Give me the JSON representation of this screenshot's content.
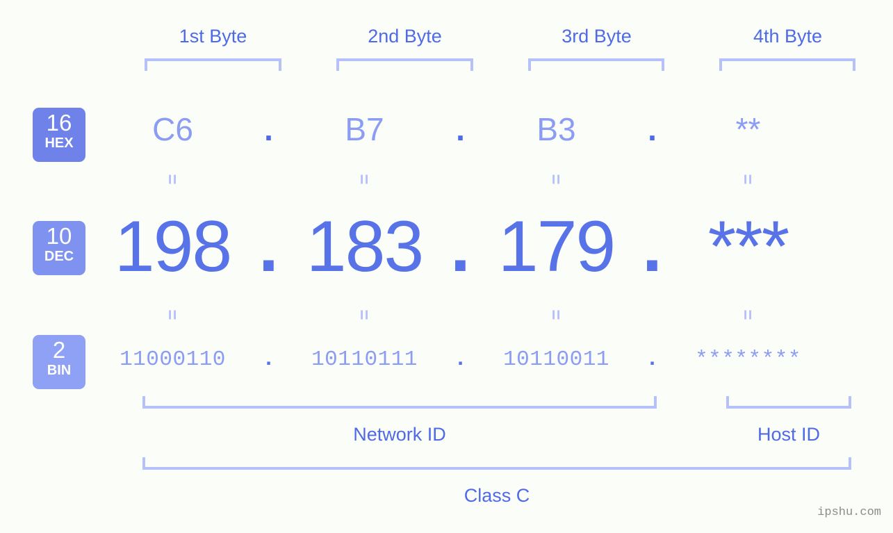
{
  "background_color": "#fbfdf8",
  "accent_colors": {
    "label_blue": "#4f6ae6",
    "value_blue": "#5872e8",
    "light_blue": "#8b9cf3",
    "bracket_blue": "#b6c0fa",
    "badge_hex": "#6e82ea",
    "badge_dec": "#7f92f0",
    "badge_bin": "#8fa1f5",
    "watermark_gray": "#8c8c8c"
  },
  "byte_headers": [
    {
      "label": "1st Byte"
    },
    {
      "label": "2nd Byte"
    },
    {
      "label": "3rd Byte"
    },
    {
      "label": "4th Byte"
    }
  ],
  "bases": {
    "hex": {
      "number": "16",
      "abbr": "HEX"
    },
    "dec": {
      "number": "10",
      "abbr": "DEC"
    },
    "bin": {
      "number": "2",
      "abbr": "BIN"
    }
  },
  "rows": {
    "hex": {
      "values": [
        "C6",
        "B7",
        "B3",
        "**"
      ],
      "separator": "."
    },
    "dec": {
      "values": [
        "198",
        "183",
        "179",
        "***"
      ],
      "separator": "."
    },
    "bin": {
      "values": [
        "11000110",
        "10110111",
        "10110011",
        "********"
      ],
      "separator": "."
    }
  },
  "equals_separator": "=",
  "groups": {
    "network_id": "Network ID",
    "host_id": "Host ID",
    "class": "Class C"
  },
  "watermark": "ipshu.com"
}
